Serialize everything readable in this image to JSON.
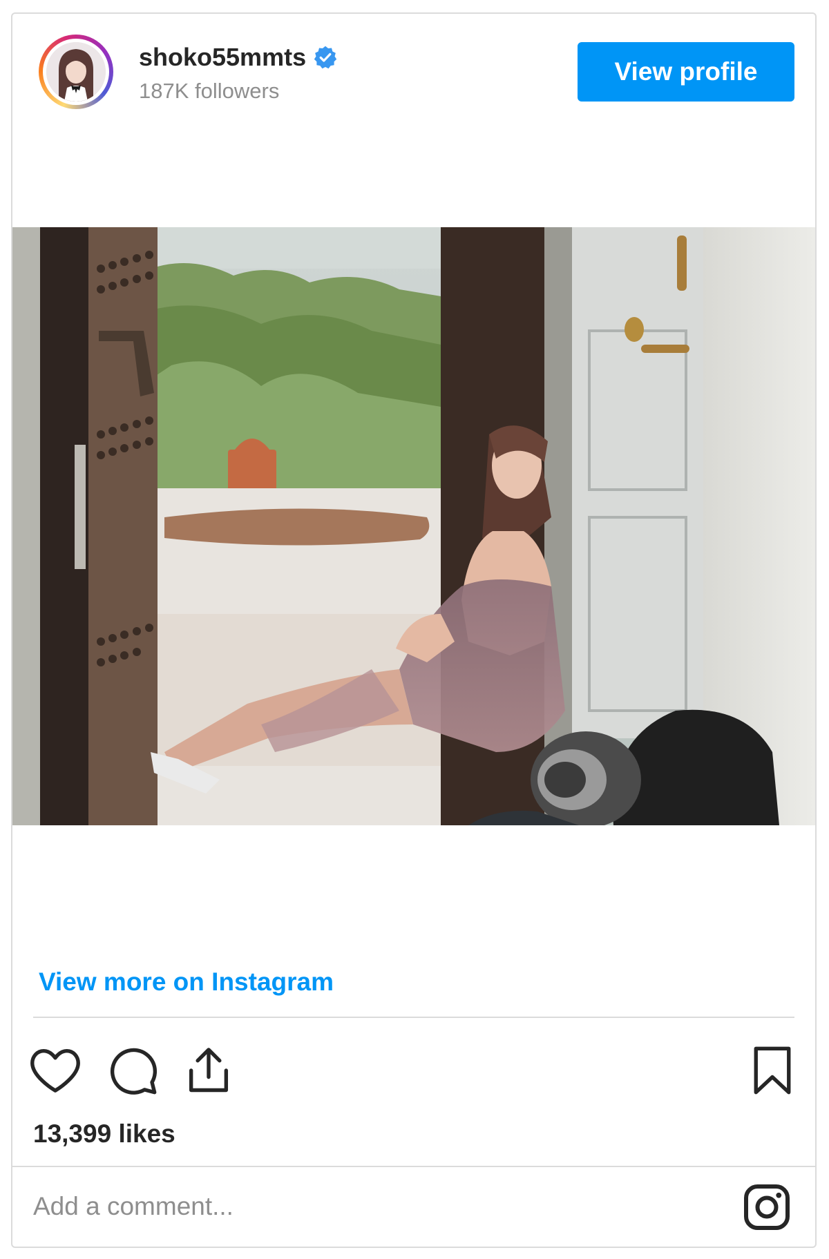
{
  "post": {
    "username": "shoko55mmts",
    "verified": true,
    "followers": "187K followers",
    "view_profile_label": "View profile",
    "view_more_label": "View more on Instagram",
    "likes": "13,399 likes",
    "comment_placeholder": "Add a comment...",
    "photo_alt": "Woman in a mauve tulle dress sitting in an open doorway"
  },
  "icons": {
    "like": "heart-icon",
    "comment": "comment-icon",
    "share": "share-icon",
    "save": "bookmark-icon",
    "brand": "instagram-icon",
    "verified": "verified-badge-icon"
  },
  "colors": {
    "accent": "#0095f6",
    "text": "#262626",
    "muted": "#8e8e8e",
    "border": "#dbdbdb",
    "verified": "#3897f0"
  }
}
